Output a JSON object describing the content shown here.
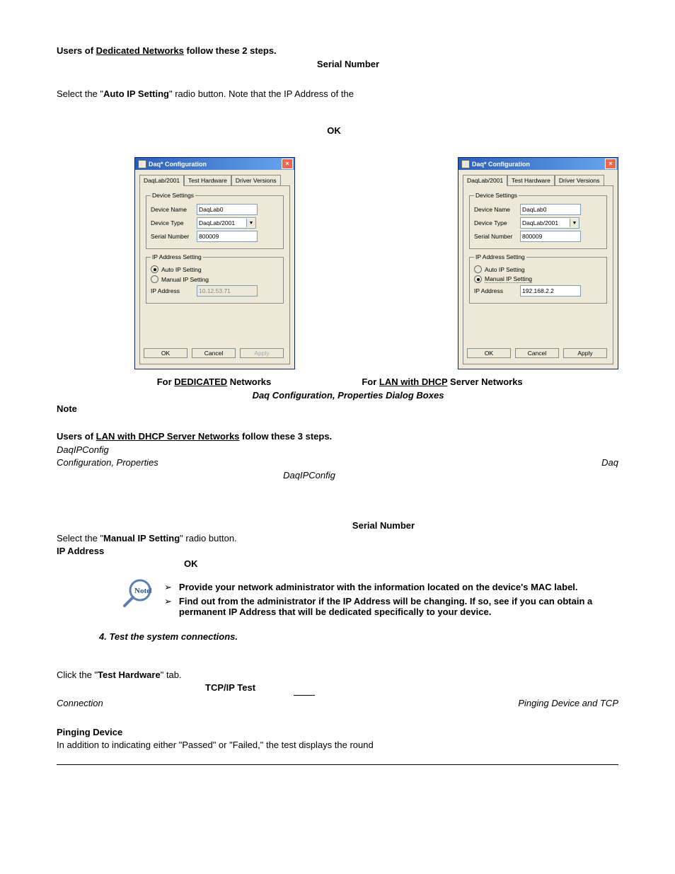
{
  "headings": {
    "dedicated_intro_pre": "Users of ",
    "dedicated_intro_link": "Dedicated Networks",
    "dedicated_intro_post": " follow these 2 steps.",
    "serial_number": "Serial Number",
    "ok": "OK",
    "lan_intro_pre": "Users of ",
    "lan_intro_link": "LAN with DHCP Server Networks",
    "lan_intro_post": " follow these 3 steps.",
    "daqipconfig": "DaqIPConfig",
    "daq_line_right": "Daq",
    "config_props": "Configuration, Properties",
    "daqipconfig2": "DaqIPConfig",
    "serial_number2": "Serial Number",
    "ip_address": "IP Address",
    "ok2": "OK",
    "test_hw_tab": "Test Hardware",
    "tcpip_test": "TCP/IP Test",
    "pinging_tcp": "Pinging Device and TCP",
    "connection": "Connection",
    "pinging_device": "Pinging Device"
  },
  "body": {
    "select_auto_pre": "Select the \"",
    "select_auto_bold": "Auto IP Setting",
    "select_auto_post": "\" radio button.  Note that the IP Address of the",
    "select_manual_pre": "Select the \"",
    "select_manual_bold": "Manual IP Setting",
    "select_manual_post": "\" radio button.",
    "click_pre": "Click the \"",
    "click_post": "\" tab.",
    "passed_failed": "In addition to indicating either \"Passed\" or \"Failed,\" the test displays the round"
  },
  "captions": {
    "left_pre": "For ",
    "left_link": "DEDICATED",
    "left_post": " Networks",
    "right_pre": "For ",
    "right_link": "LAN with DHCP",
    "right_post": " Server Networks",
    "fig": "Daq Configuration, Properties Dialog Boxes"
  },
  "note_label": "Note",
  "note_bullets": {
    "b1": "Provide your network administrator with the information located on the device's MAC label.",
    "b2": "Find out from the administrator if the IP Address will be changing.  If so, see if you can obtain a permanent IP Address that will be dedicated specifically to your device."
  },
  "step4": "4.  Test the system connections.",
  "dialog_common": {
    "title": "Daq* Configuration",
    "tab1": "DaqLab/2001",
    "tab2": "Test Hardware",
    "tab3": "Driver Versions",
    "legend_device": "Device Settings",
    "legend_ip": "IP Address Setting",
    "lbl_name": "Device Name",
    "lbl_type": "Device Type",
    "lbl_serial": "Serial Number",
    "lbl_ipaddr": "IP Address",
    "radio_auto": "Auto IP Setting",
    "radio_manual": "Manual IP Setting",
    "btn_ok": "OK",
    "btn_cancel": "Cancel",
    "btn_apply": "Apply"
  },
  "dialog_left": {
    "name": "DaqLab0",
    "type": "DaqLab/2001",
    "serial": "800009",
    "ip": "10.12.53.71",
    "auto_checked": true,
    "manual_checked": false,
    "ip_disabled": true,
    "apply_disabled": true
  },
  "dialog_right": {
    "name": "DaqLab0",
    "type": "DaqLab/2001",
    "serial": "800009",
    "ip": "192.168.2.2",
    "auto_checked": false,
    "manual_checked": true,
    "ip_disabled": false,
    "apply_disabled": false
  }
}
